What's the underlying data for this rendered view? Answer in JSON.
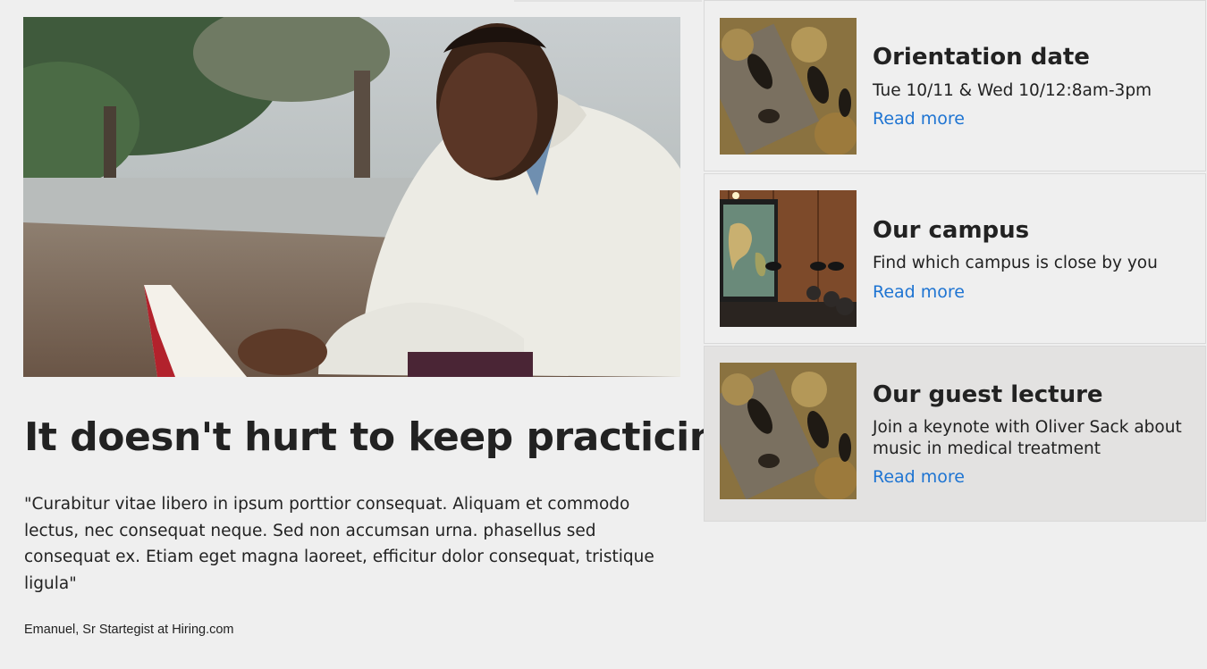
{
  "feature": {
    "image_alt": "Man reading a book outdoors",
    "headline": "It doesn't hurt to keep practicing",
    "quote": "\"Curabitur vitae libero in ipsum porttior consequat. Aliquam et commodo lectus, nec consequat neque. Sed non accumsan urna. phasellus sed consequat ex. Etiam eget magna laoreet, efficitur dolor consequat, tristique ligula\"",
    "attribution": "Emanuel, Sr Startegist at Hiring.com"
  },
  "cards": [
    {
      "title": "Orientation date",
      "description": "Tue 10/11 & Wed 10/12:8am-3pm",
      "link_label": "Read more"
    },
    {
      "title": "Our campus",
      "description": "Find which campus is close by you",
      "link_label": "Read more"
    },
    {
      "title": "Our guest lecture",
      "description": "Join a keynote with Oliver Sack about music in medical treatment",
      "link_label": "Read more"
    }
  ],
  "colors": {
    "background": "#efefef",
    "highlight_card": "#e3e2e1",
    "link": "#1e74d2",
    "text": "#222222"
  }
}
